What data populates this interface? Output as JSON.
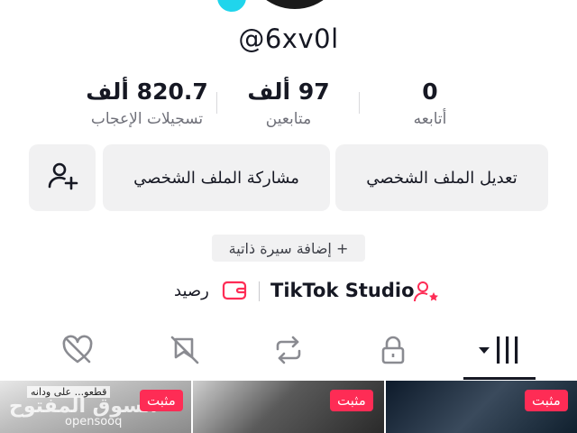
{
  "profile": {
    "username": "@6xv0l"
  },
  "stats": {
    "following": {
      "value": "0",
      "label": "أتابعه"
    },
    "followers": {
      "value": "97 ألف",
      "label": "متابعين"
    },
    "likes": {
      "value": "820.7 ألف",
      "label": "تسجيلات الإعجاب"
    }
  },
  "actions": {
    "edit_profile": "تعديل الملف الشخصي",
    "share_profile": "مشاركة الملف الشخصي",
    "add_friend_icon": "add-user-icon"
  },
  "bio": {
    "add_bio": "+ إضافة سيرة ذاتية"
  },
  "links": {
    "studio": "TikTok Studio",
    "balance": "رصيد"
  },
  "tabs": [
    {
      "icon": "grid-icon",
      "selected": true
    },
    {
      "icon": "lock-icon",
      "selected": false
    },
    {
      "icon": "repost-icon",
      "selected": false
    },
    {
      "icon": "bookmark-hidden-icon",
      "selected": false
    },
    {
      "icon": "liked-hidden-icon",
      "selected": false
    }
  ],
  "videos": [
    {
      "pinned_label": "مثبت",
      "caption": "قطعو... على ودانه",
      "watermark": "السوق المفتوح",
      "watermark_latin": "opensooq"
    },
    {
      "pinned_label": "مثبت"
    },
    {
      "pinned_label": "مثبت"
    }
  ],
  "colors": {
    "accent": "#fe2c55",
    "button_bg": "#f1f1f2",
    "text": "#161823",
    "secondary_text": "#6f7079"
  }
}
